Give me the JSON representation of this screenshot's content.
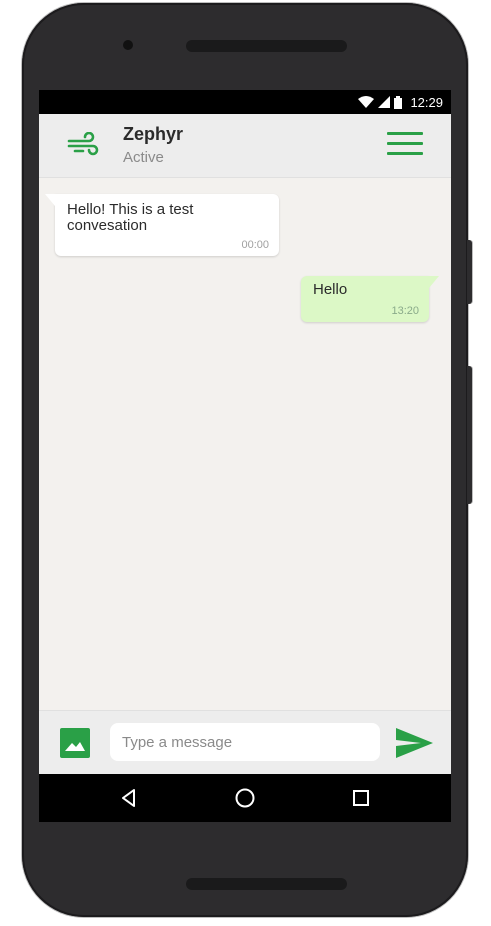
{
  "status_bar": {
    "time": "12:29",
    "icons": [
      "wifi-icon",
      "signal-icon",
      "battery-icon"
    ]
  },
  "header": {
    "icon": "wind-icon",
    "name": "Zephyr",
    "status": "Active",
    "menu_icon": "hamburger-menu-icon"
  },
  "messages": [
    {
      "direction": "incoming",
      "text": "Hello! This is a test\nconvesation",
      "time": "00:00"
    },
    {
      "direction": "outgoing",
      "text": "Hello",
      "time": "13:20"
    }
  ],
  "composer": {
    "image_icon": "image-icon",
    "placeholder": "Type a message",
    "value": "",
    "send_icon": "send-icon"
  },
  "nav_bar": {
    "icons": [
      "back-icon",
      "home-icon",
      "recents-icon"
    ]
  },
  "colors": {
    "accent": "#2aa047",
    "outgoing_bubble": "#dcf8c6",
    "incoming_bubble": "#ffffff",
    "chat_background": "#f3f1ee",
    "header_background": "#ededed"
  }
}
